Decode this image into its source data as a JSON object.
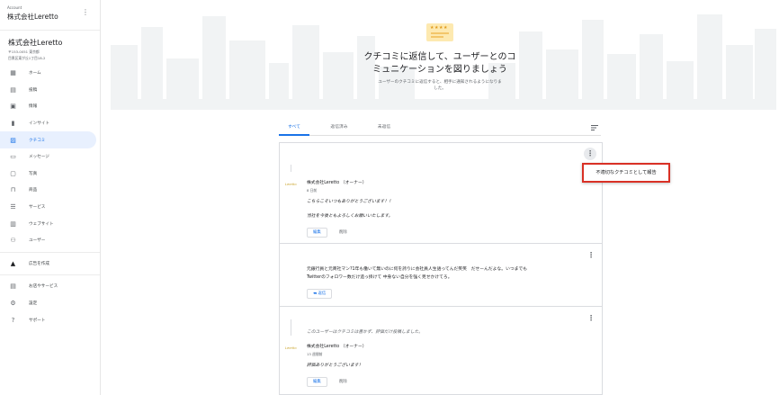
{
  "account": {
    "label": "Account",
    "name": "株式会社Leretto"
  },
  "business": {
    "name": "株式会社Leretto",
    "address_line1": "〒153-0051 東京都",
    "address_line2": "目黒区東が丘1丁目18-2"
  },
  "nav": {
    "items": [
      {
        "icon": "dashboard-icon",
        "glyph": "▦",
        "label": "ホーム"
      },
      {
        "icon": "post-icon",
        "glyph": "▤",
        "label": "投稿"
      },
      {
        "icon": "info-icon",
        "glyph": "▣",
        "label": "情報"
      },
      {
        "icon": "insights-icon",
        "glyph": "▮",
        "label": "インサイト"
      },
      {
        "icon": "reviews-icon",
        "glyph": "▨",
        "label": "クチコミ"
      },
      {
        "icon": "messages-icon",
        "glyph": "▭",
        "label": "メッセージ"
      },
      {
        "icon": "photos-icon",
        "glyph": "▢",
        "label": "写真"
      },
      {
        "icon": "products-icon",
        "glyph": "⊓",
        "label": "商品"
      },
      {
        "icon": "services-icon",
        "glyph": "☰",
        "label": "サービス"
      },
      {
        "icon": "website-icon",
        "glyph": "▥",
        "label": "ウェブサイト"
      },
      {
        "icon": "users-icon",
        "glyph": "⚇",
        "label": "ユーザー"
      }
    ],
    "ads": {
      "icon": "ads-icon",
      "glyph": "▲",
      "label": "広告を作成"
    },
    "bottom": [
      {
        "icon": "store-icon",
        "glyph": "▤",
        "label": "お店やサービス"
      },
      {
        "icon": "settings-icon",
        "glyph": "⚙",
        "label": "設定"
      },
      {
        "icon": "help-icon",
        "glyph": "?",
        "label": "サポート"
      }
    ],
    "active_index": 4
  },
  "hero": {
    "title_line1": "クチコミに返信して、ユーザーとのコ",
    "title_line2": "ミュニケーションを図りましょう",
    "subtitle_line1": "ユーザーのクチコミに返信すると、相手に通知されるようになりま",
    "subtitle_line2": "した。",
    "stars": "★★★★"
  },
  "tabs": [
    {
      "label": "すべて"
    },
    {
      "label": "返信済み"
    },
    {
      "label": "未返信"
    }
  ],
  "reviews": [
    {
      "owner": "株式会社Leretto （オーナー）",
      "ago": "8 日前",
      "reply_line1": "こちらこそいつもありがとうございます！！",
      "reply_line2": "当社を今後ともよろしくお願いいたします。",
      "edit": "編集",
      "delete": "削除",
      "logo": "Leretto"
    },
    {
      "text_line1": "元銀行員と元商社マン?1年も働いて無いのに何を誇りに会社員人生語ってんだ笑笑　だせーんだよな。いつまでも",
      "text_line2": "Twitterのフォロワー数だけ追っ掛けて 中身ない自分を強く見せかけてろ。",
      "reply_button": "返信"
    },
    {
      "note": "このユーザーはクチコミは書かず、評価だけ投稿しました。",
      "owner": "株式会社Leretto （オーナー）",
      "ago": "13 週間前",
      "reply_line1": "評価ありがとうございます！",
      "edit": "編集",
      "delete": "削除",
      "logo": "Leretto"
    }
  ],
  "report_menu": {
    "label": "不適切なクチコミとして報告"
  },
  "colors": {
    "accent": "#1a73e8",
    "report_border": "#d93025",
    "skyline": "#f1f3f4"
  }
}
